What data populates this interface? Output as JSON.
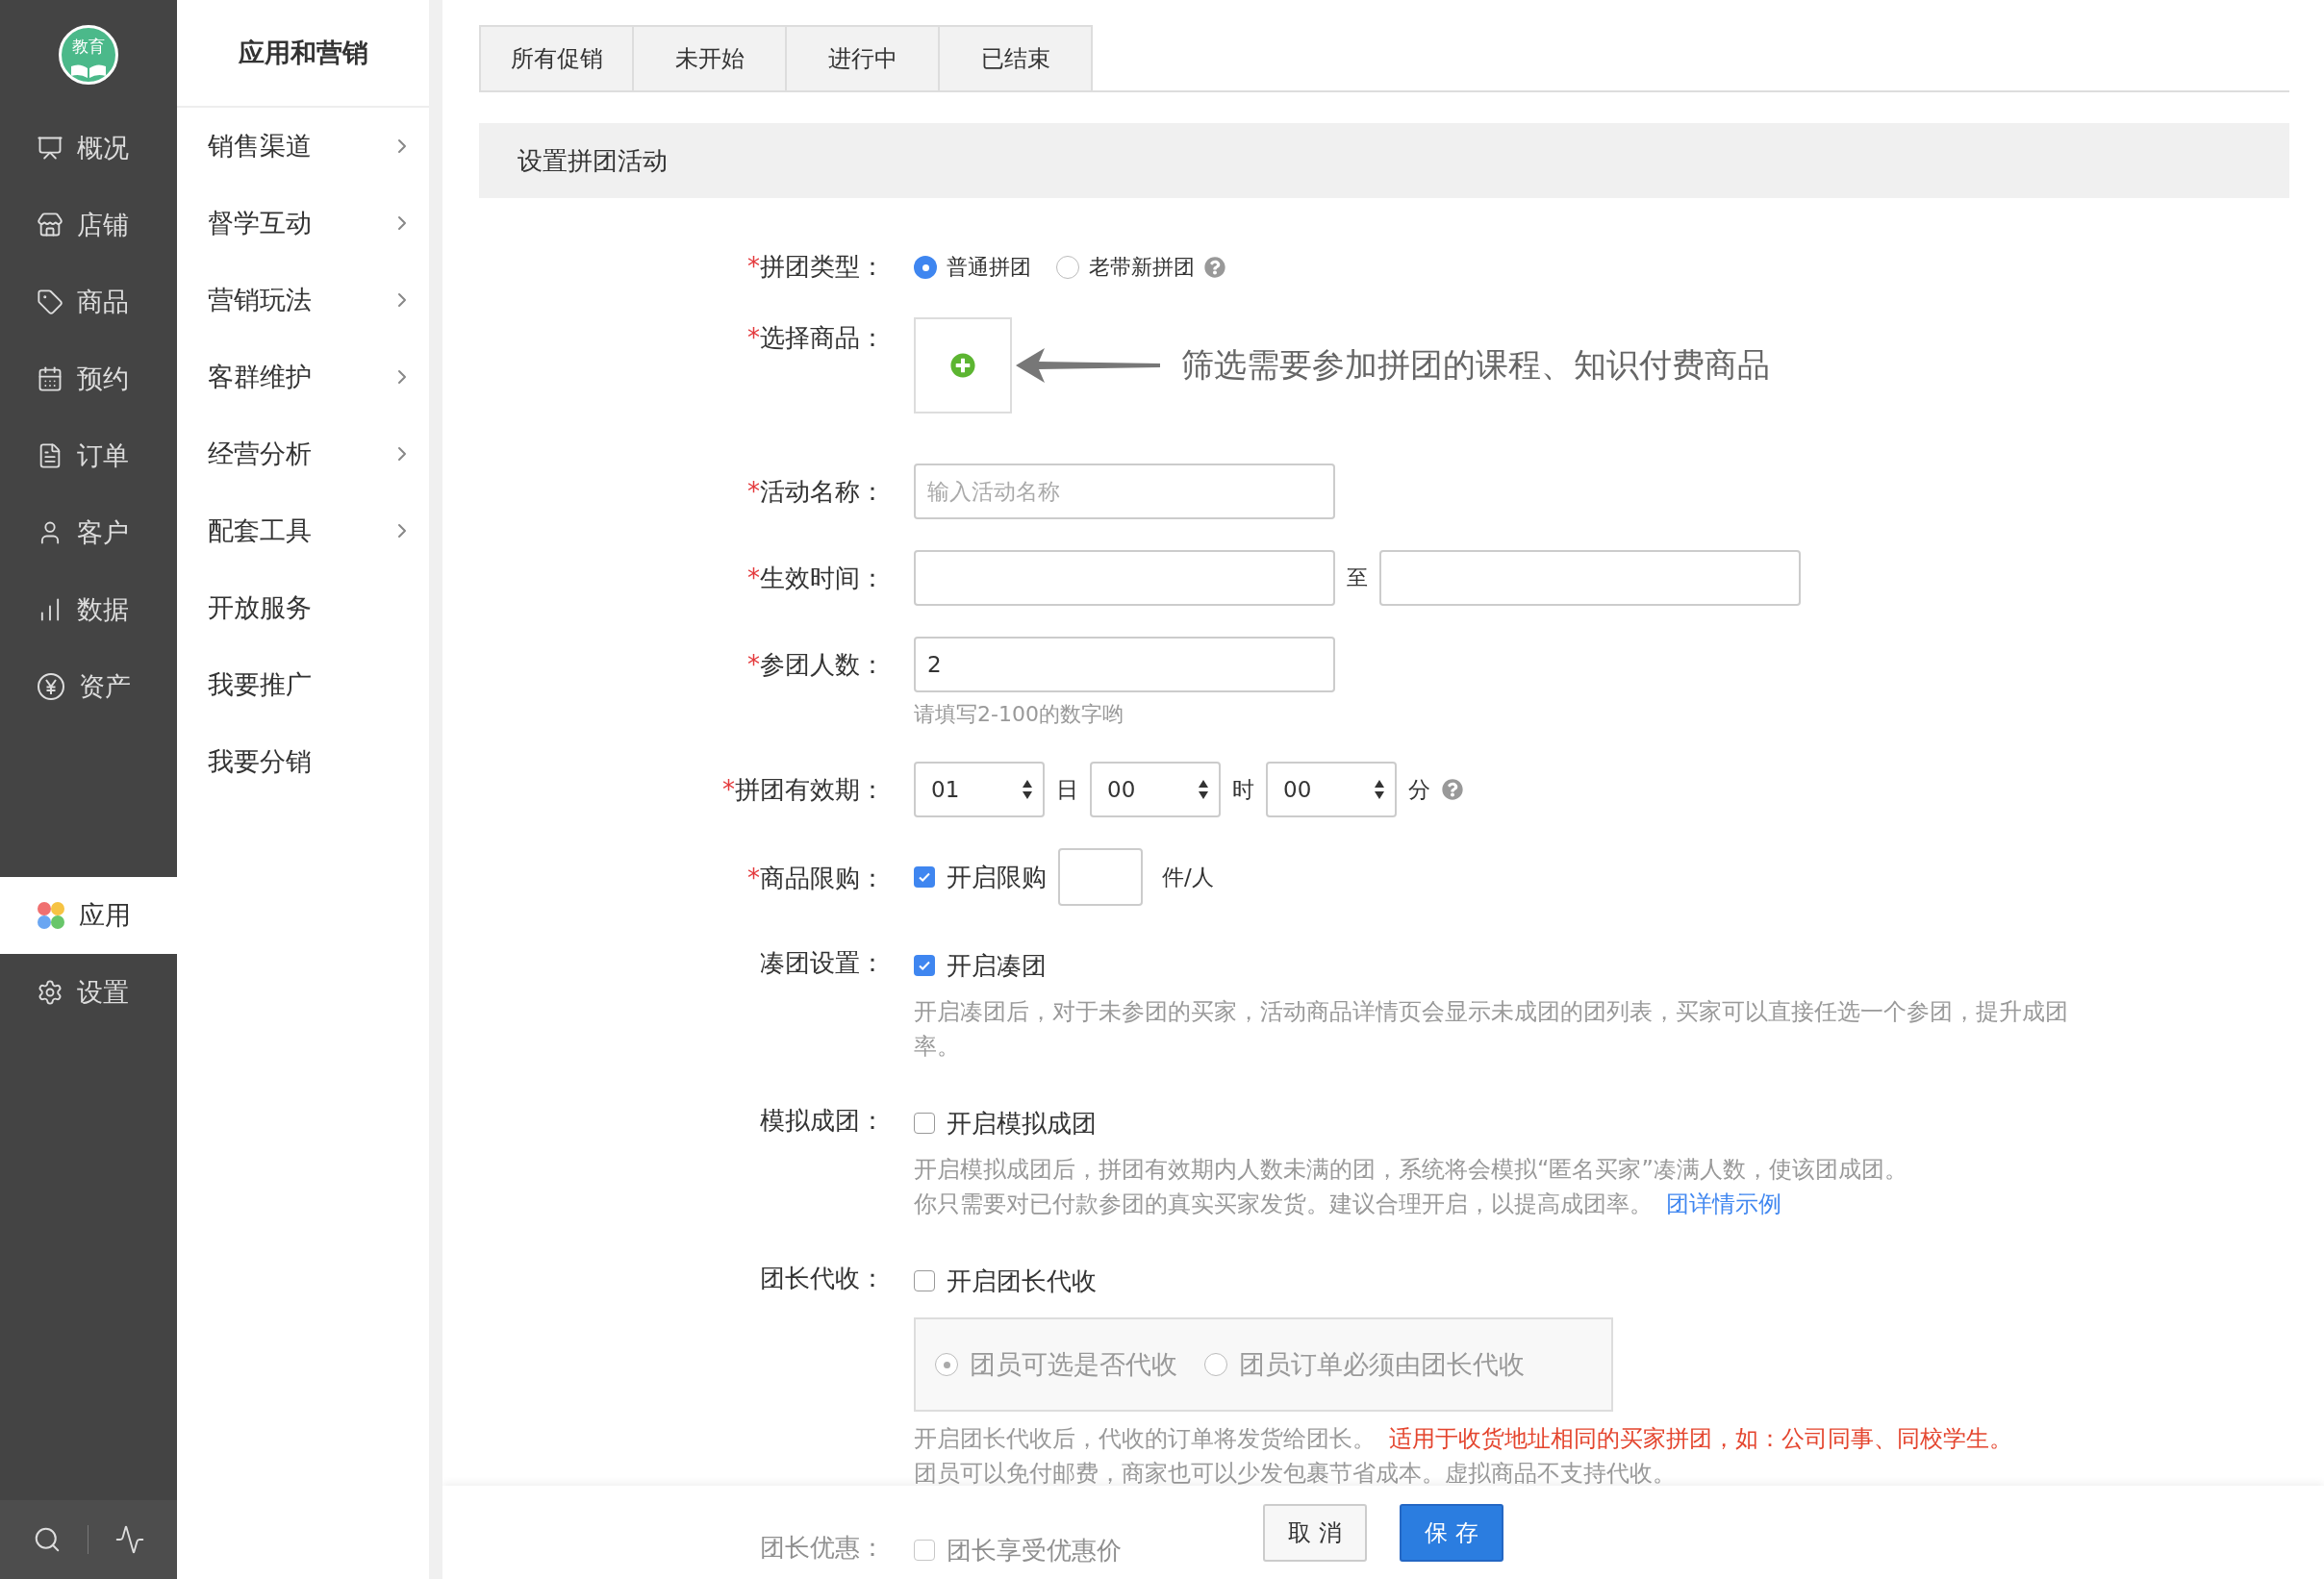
{
  "logo": {
    "text": "教育"
  },
  "nav_top": [
    {
      "label": "概况",
      "selected": false
    },
    {
      "label": "店铺",
      "selected": false
    },
    {
      "label": "商品",
      "selected": false
    },
    {
      "label": "预约",
      "selected": false
    },
    {
      "label": "订单",
      "selected": false
    },
    {
      "label": "客户",
      "selected": false
    },
    {
      "label": "数据",
      "selected": false
    },
    {
      "label": "资产",
      "selected": false
    }
  ],
  "nav_apps": [
    {
      "label": "应用",
      "selected": true
    },
    {
      "label": "设置",
      "selected": false
    }
  ],
  "submenu": {
    "title": "应用和营销",
    "items": [
      {
        "label": "销售渠道",
        "expandable": true
      },
      {
        "label": "督学互动",
        "expandable": true
      },
      {
        "label": "营销玩法",
        "expandable": true
      },
      {
        "label": "客群维护",
        "expandable": true
      },
      {
        "label": "经营分析",
        "expandable": true
      },
      {
        "label": "配套工具",
        "expandable": true
      },
      {
        "label": "开放服务",
        "expandable": false
      },
      {
        "label": "我要推广",
        "expandable": false
      },
      {
        "label": "我要分销",
        "expandable": false
      }
    ]
  },
  "tabs": [
    {
      "label": "所有促销",
      "selected": false
    },
    {
      "label": "未开始",
      "selected": false
    },
    {
      "label": "进行中",
      "selected": false
    },
    {
      "label": "已结束",
      "selected": false
    }
  ],
  "section_title": "设置拼团活动",
  "form": [
    {
      "kind": "radio",
      "mark": "*",
      "label": "拼团类型：",
      "options": [
        {
          "label": "普通拼团",
          "selected": true,
          "help": false
        },
        {
          "label": "老带新拼团",
          "selected": false,
          "help": true
        }
      ]
    },
    {
      "kind": "product",
      "mark": "*",
      "label": "选择商品：",
      "annotation": "筛选需要参加拼团的课程、知识付费商品"
    },
    {
      "kind": "text",
      "mark": "*",
      "label": "活动名称：",
      "placeholder": "输入活动名称"
    },
    {
      "kind": "daterange",
      "mark": "*",
      "label": "生效时间：",
      "separator": "至"
    },
    {
      "kind": "number",
      "mark": "*",
      "label": "参团人数：",
      "value": "2",
      "hint": "请填写2-100的数字哟"
    },
    {
      "kind": "duration",
      "mark": "*",
      "label": "拼团有效期：",
      "parts": [
        {
          "value": "01",
          "unit": "日"
        },
        {
          "value": "00",
          "unit": "时"
        },
        {
          "value": "00",
          "unit": "分"
        }
      ],
      "help": true
    },
    {
      "kind": "limit",
      "mark": "*",
      "label": "商品限购：",
      "checkbox": {
        "label": "开启限购",
        "checked": true
      },
      "unit": "件/人"
    },
    {
      "kind": "toggle",
      "label": "凑团设置：",
      "checkbox": {
        "label": "开启凑团",
        "checked": true
      },
      "description": [
        {
          "text": "开启凑团后，对于未参团的买家，活动商品详情页会显示未成团的团列表，买家可以直接任选一个参团，提升成团率。"
        }
      ]
    },
    {
      "kind": "toggle",
      "label": "模拟成团：",
      "checkbox": {
        "label": "开启模拟成团",
        "checked": false
      },
      "description": [
        {
          "text": "开启模拟成团后，拼团有效期内人数未满的团，系统将会模拟“匿名买家”凑满人数，使该团成团。"
        },
        {
          "text": "你只需要对已付款参团的真实买家发货。建议合理开启，以提高成团率。",
          "link": "团详情示例"
        }
      ]
    },
    {
      "kind": "collect",
      "label": "团长代收：",
      "checkbox": {
        "label": "开启团长代收",
        "checked": false
      },
      "options": [
        {
          "label": "团员可选是否代收",
          "selected": true
        },
        {
          "label": "团员订单必须由团长代收",
          "selected": false
        }
      ],
      "notes": [
        [
          {
            "text": "开启团长代收后，代收的订单将发货给团长。",
            "warning": false
          },
          {
            "text": "适用于收货地址相同的买家拼团，如：公司同事、同校学生。",
            "warning": true
          }
        ],
        [
          {
            "text": "团员可以免付邮费，商家也可以少发包裹节省成本。虚拟商品不支持代收。",
            "warning": false
          }
        ]
      ]
    },
    {
      "kind": "toggle",
      "label": "团长优惠：",
      "checkbox": {
        "label": "团长享受优惠价",
        "checked": false
      }
    }
  ],
  "footer": {
    "buttons": [
      {
        "label": "取 消",
        "kind": "secondary"
      },
      {
        "label": "保 存",
        "kind": "primary"
      }
    ]
  }
}
